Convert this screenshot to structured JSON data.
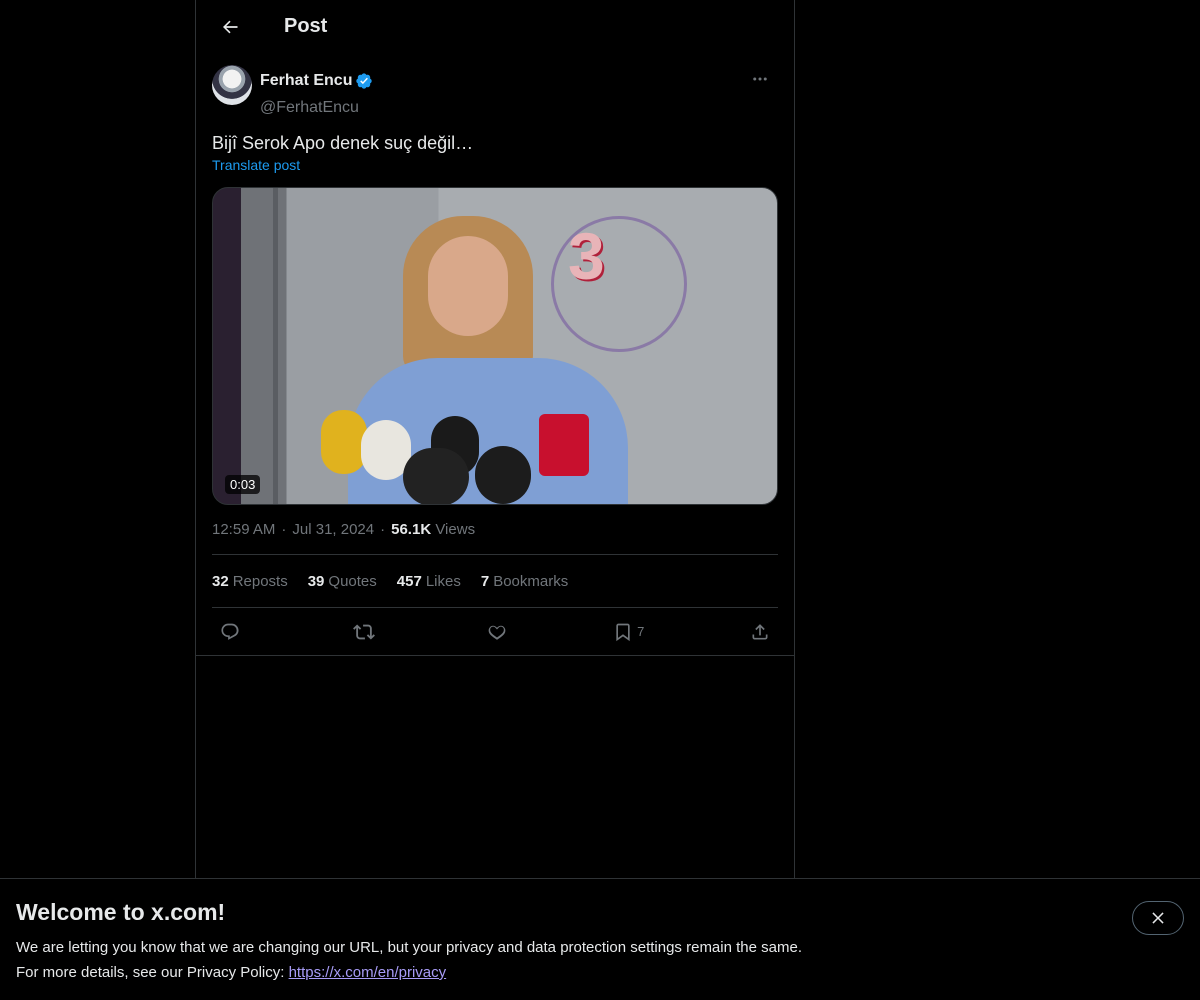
{
  "header": {
    "title": "Post"
  },
  "post": {
    "author": {
      "display_name": "Ferhat Encu",
      "handle": "@FerhatEncu"
    },
    "text": "Bijî Serok Apo denek suç değil…",
    "translate_label": "Translate post",
    "media": {
      "duration": "0:03"
    },
    "time": "12:59 AM",
    "date": "Jul 31, 2024",
    "views_count": "56.1K",
    "views_label": "Views",
    "stats": [
      {
        "count": "32",
        "label": "Reposts"
      },
      {
        "count": "39",
        "label": "Quotes"
      },
      {
        "count": "457",
        "label": "Likes"
      },
      {
        "count": "7",
        "label": "Bookmarks"
      }
    ],
    "actions": {
      "bookmark_count": "7"
    }
  },
  "banner": {
    "title": "Welcome to x.com!",
    "line1": "We are letting you know that we are changing our URL, but your privacy and data protection settings remain the same.",
    "line2_prefix": "For more details, see our Privacy Policy: ",
    "link": "https://x.com/en/privacy"
  },
  "colors": {
    "accent": "#1d9bf0",
    "background": "#000000",
    "muted": "#71767b",
    "link": "#a89cf7"
  }
}
